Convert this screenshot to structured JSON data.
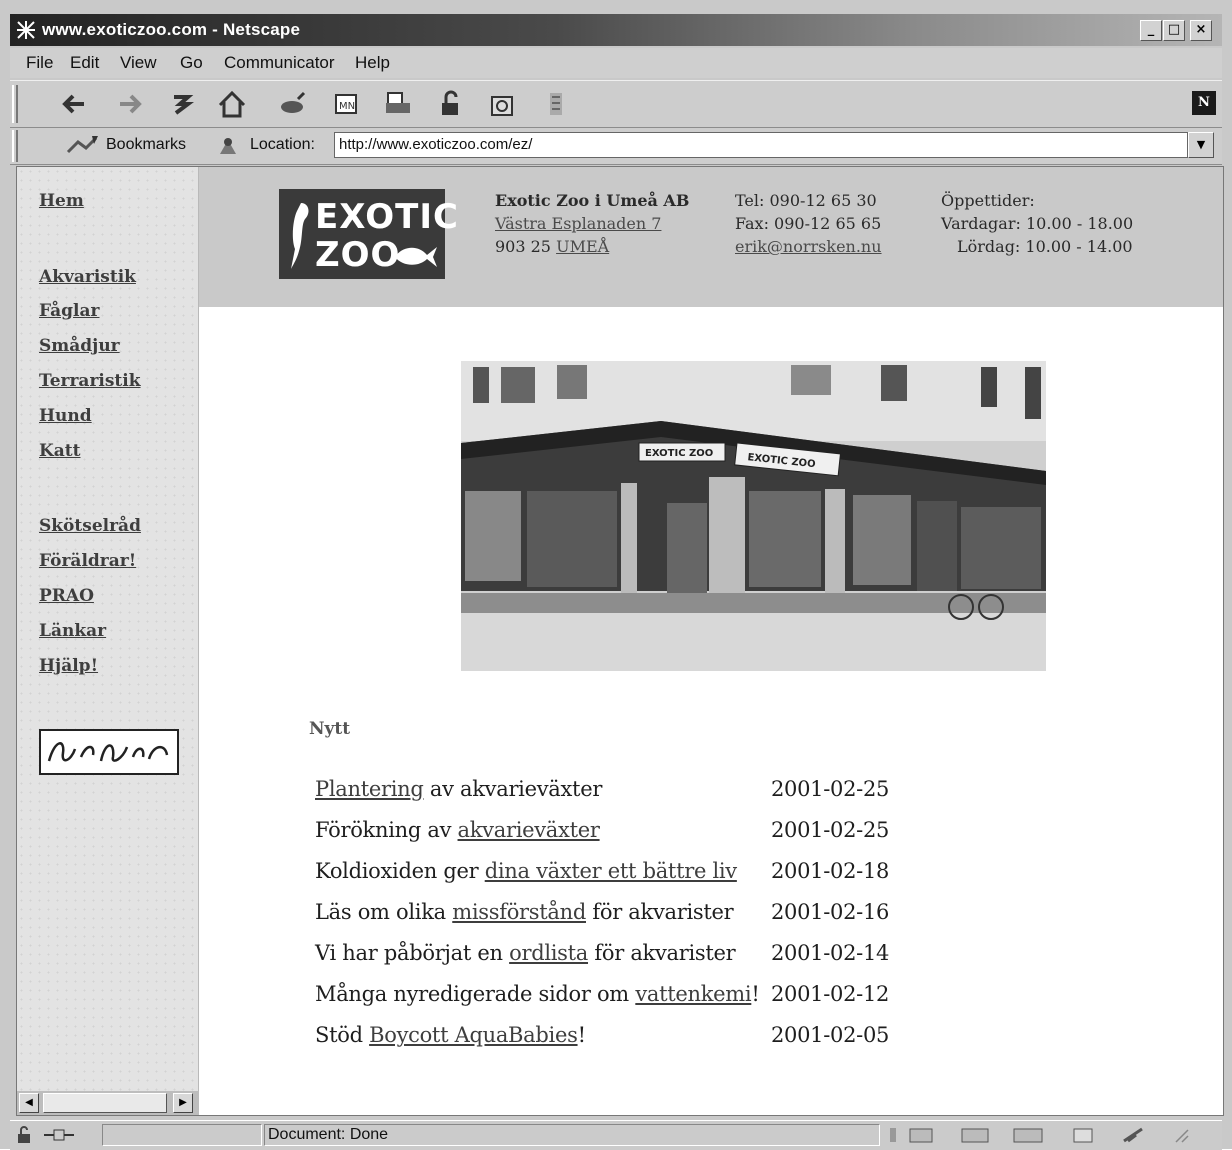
{
  "window": {
    "title": "www.exoticzoo.com - Netscape"
  },
  "menu": [
    "File",
    "Edit",
    "View",
    "Go",
    "Communicator",
    "Help"
  ],
  "toolbar_icons": [
    "back-icon",
    "forward-icon",
    "reload-icon",
    "home-icon",
    "search-icon",
    "netscape-guide-icon",
    "print-icon",
    "security-icon",
    "shop-icon",
    "stop-icon"
  ],
  "location_bar": {
    "bookmarks_label": "Bookmarks",
    "location_label": "Location:",
    "url": "http://www.exoticzoo.com/ez/"
  },
  "sidebar": {
    "links_top": [
      "Hem"
    ],
    "links_animals": [
      "Akvaristik",
      "Fåglar",
      "Smådjur",
      "Terraristik",
      "Hund",
      "Katt"
    ],
    "links_info": [
      "Skötselråd",
      "Föräldrar!",
      "PRAO",
      "Länkar",
      "Hjälp!"
    ]
  },
  "header": {
    "logo_line1": "EXOTIC",
    "logo_line2": "ZOO",
    "company": "Exotic Zoo i Umeå AB",
    "street": "Västra Esplanaden 7",
    "postcode": "903 25",
    "city": "UMEÅ",
    "phone": "Tel: 090-12 65 30",
    "fax": "Fax: 090-12 65 65",
    "email": "erik@norrsken.nu",
    "hours_title": "Öppettider:",
    "hours_weekday": "Vardagar: 10.00 - 18.00",
    "hours_saturday": "Lördag: 10.00 - 14.00"
  },
  "storefront": {
    "sign1": "EXOTIC ZOO",
    "sign2": "EXOTIC ZOO"
  },
  "news": {
    "heading": "Nytt",
    "items": [
      {
        "before": "",
        "link": "Plantering",
        "after": " av akvarieväxter",
        "date": "2001-02-25"
      },
      {
        "before": "Förökning av ",
        "link": "akvarieväxter",
        "after": "",
        "date": "2001-02-25"
      },
      {
        "before": "Koldioxiden ger ",
        "link": "dina växter ett bättre liv",
        "after": "",
        "date": "2001-02-18"
      },
      {
        "before": "Läs om olika ",
        "link": "missförstånd",
        "after": " för akvarister",
        "date": "2001-02-16"
      },
      {
        "before": "Vi har påbörjat en ",
        "link": "ordlista",
        "after": " för akvarister",
        "date": "2001-02-14"
      },
      {
        "before": "Många nyredigerade sidor om ",
        "link": "vattenkemi",
        "after": "!",
        "date": "2001-02-12"
      },
      {
        "before": "Stöd ",
        "link": "Boycott AquaBabies",
        "after": "!",
        "date": "2001-02-05"
      }
    ]
  },
  "status": {
    "text": "Document: Done"
  },
  "colors": {
    "header_bg": "#c9c9c9",
    "sidebar_bg": "#e3e3e3",
    "logo_bg": "#3a3a3a"
  }
}
